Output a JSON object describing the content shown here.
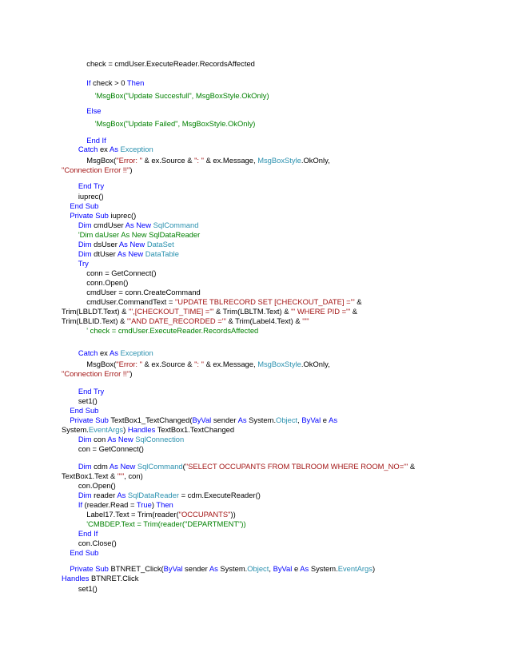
{
  "colors": {
    "default": "#000000",
    "keyword": "#0000ff",
    "type": "#2b91af",
    "string": "#a31515",
    "comment": "#008000"
  },
  "lines": [
    [
      [
        "            check = cmdUser.ExecuteReader.RecordsAffected",
        "default"
      ]
    ],
    [
      [
        "            ",
        "default"
      ],
      [
        "If",
        "keyword"
      ],
      [
        " check > 0 ",
        "default"
      ],
      [
        "Then",
        "keyword"
      ]
    ],
    [
      [
        "                ",
        "default"
      ],
      [
        "'MsgBox(\"Update Succesfull\", MsgBoxStyle.OkOnly)",
        "comment"
      ]
    ],
    [
      [
        "            ",
        "default"
      ],
      [
        "Else",
        "keyword"
      ]
    ],
    [
      [
        "                ",
        "default"
      ],
      [
        "'MsgBox(\"Update Failed\", MsgBoxStyle.OkOnly)",
        "comment"
      ]
    ],
    [
      [
        "            ",
        "default"
      ],
      [
        "End If",
        "keyword"
      ]
    ],
    [
      [
        "        ",
        "default"
      ],
      [
        "Catch",
        "keyword"
      ],
      [
        " ex ",
        "default"
      ],
      [
        "As",
        "keyword"
      ],
      [
        " ",
        "default"
      ],
      [
        "Exception",
        "type"
      ]
    ],
    [
      [
        "            MsgBox(",
        "default"
      ],
      [
        "\"Error: \"",
        "string"
      ],
      [
        " & ex.Source & ",
        "default"
      ],
      [
        "\": \"",
        "string"
      ],
      [
        " & ex.Message, ",
        "default"
      ],
      [
        "MsgBoxStyle",
        "type"
      ],
      [
        ".OkOnly,",
        "default"
      ]
    ],
    [
      [
        "\"Connection Error !!\"",
        "string"
      ],
      [
        ")",
        "default"
      ]
    ],
    [
      [
        "        ",
        "default"
      ],
      [
        "End Try",
        "keyword"
      ]
    ],
    [
      [
        "        iuprec()",
        "default"
      ]
    ],
    [
      [
        "    ",
        "default"
      ],
      [
        "End Sub",
        "keyword"
      ]
    ],
    [
      [
        "    ",
        "default"
      ],
      [
        "Private Sub",
        "keyword"
      ],
      [
        " iuprec()",
        "default"
      ]
    ],
    [
      [
        "        ",
        "default"
      ],
      [
        "Dim",
        "keyword"
      ],
      [
        " cmdUser ",
        "default"
      ],
      [
        "As New",
        "keyword"
      ],
      [
        " ",
        "default"
      ],
      [
        "SqlCommand",
        "type"
      ]
    ],
    [
      [
        "        ",
        "default"
      ],
      [
        "'Dim daUser As New SqlDataReader",
        "comment"
      ]
    ],
    [
      [
        "        ",
        "default"
      ],
      [
        "Dim",
        "keyword"
      ],
      [
        " dsUser ",
        "default"
      ],
      [
        "As New",
        "keyword"
      ],
      [
        " ",
        "default"
      ],
      [
        "DataSet",
        "type"
      ]
    ],
    [
      [
        "        ",
        "default"
      ],
      [
        "Dim",
        "keyword"
      ],
      [
        " dtUser ",
        "default"
      ],
      [
        "As New",
        "keyword"
      ],
      [
        " ",
        "default"
      ],
      [
        "DataTable",
        "type"
      ]
    ],
    [
      [
        "        ",
        "default"
      ],
      [
        "Try",
        "keyword"
      ]
    ],
    [
      [
        "            conn = GetConnect()",
        "default"
      ]
    ],
    [
      [
        "            conn.Open()",
        "default"
      ]
    ],
    [
      [
        "            cmdUser = conn.CreateCommand",
        "default"
      ]
    ],
    [
      [
        "            cmdUser.CommandText = ",
        "default"
      ],
      [
        "\"UPDATE TBLRECORD SET [CHECKOUT_DATE] ='\"",
        "string"
      ],
      [
        " &",
        "default"
      ]
    ],
    [
      [
        "Trim(LBLDT.Text) & ",
        "default"
      ],
      [
        "\"',[CHECKOUT_TIME] ='\"",
        "string"
      ],
      [
        " & Trim(LBLTM.Text) & ",
        "default"
      ],
      [
        "\"' WHERE PID ='\"",
        "string"
      ],
      [
        " &",
        "default"
      ]
    ],
    [
      [
        "Trim(LBLID.Text) & ",
        "default"
      ],
      [
        "\"'AND DATE_RECORDED ='\"",
        "string"
      ],
      [
        " & Trim(Label4.Text) & ",
        "default"
      ],
      [
        "\"'\"",
        "string"
      ]
    ],
    [
      [
        "            ",
        "default"
      ],
      [
        "' check = cmdUser.ExecuteReader.RecordsAffected",
        "comment"
      ]
    ],
    [
      [
        "        ",
        "default"
      ],
      [
        "Catch",
        "keyword"
      ],
      [
        " ex ",
        "default"
      ],
      [
        "As",
        "keyword"
      ],
      [
        " ",
        "default"
      ],
      [
        "Exception",
        "type"
      ]
    ],
    [
      [
        "            MsgBox(",
        "default"
      ],
      [
        "\"Error: \"",
        "string"
      ],
      [
        " & ex.Source & ",
        "default"
      ],
      [
        "\": \"",
        "string"
      ],
      [
        " & ex.Message, ",
        "default"
      ],
      [
        "MsgBoxStyle",
        "type"
      ],
      [
        ".OkOnly,",
        "default"
      ]
    ],
    [
      [
        "\"Connection Error !!\"",
        "string"
      ],
      [
        ")",
        "default"
      ]
    ],
    [
      [
        "        ",
        "default"
      ],
      [
        "End Try",
        "keyword"
      ]
    ],
    [
      [
        "        set1()",
        "default"
      ]
    ],
    [
      [
        "    ",
        "default"
      ],
      [
        "End Sub",
        "keyword"
      ]
    ],
    [
      [
        "    ",
        "default"
      ],
      [
        "Private Sub",
        "keyword"
      ],
      [
        " TextBox1_TextChanged(",
        "default"
      ],
      [
        "ByVal",
        "keyword"
      ],
      [
        " sender ",
        "default"
      ],
      [
        "As",
        "keyword"
      ],
      [
        " System.",
        "default"
      ],
      [
        "Object",
        "type"
      ],
      [
        ", ",
        "default"
      ],
      [
        "ByVal",
        "keyword"
      ],
      [
        " e ",
        "default"
      ],
      [
        "As",
        "keyword"
      ]
    ],
    [
      [
        "System.",
        "default"
      ],
      [
        "EventArgs",
        "type"
      ],
      [
        ") ",
        "default"
      ],
      [
        "Handles",
        "keyword"
      ],
      [
        " TextBox1.TextChanged",
        "default"
      ]
    ],
    [
      [
        "        ",
        "default"
      ],
      [
        "Dim",
        "keyword"
      ],
      [
        " con ",
        "default"
      ],
      [
        "As New",
        "keyword"
      ],
      [
        " ",
        "default"
      ],
      [
        "SqlConnection",
        "type"
      ]
    ],
    [
      [
        "        con = GetConnect()",
        "default"
      ]
    ],
    [
      [
        "        ",
        "default"
      ],
      [
        "Dim",
        "keyword"
      ],
      [
        " cdm ",
        "default"
      ],
      [
        "As New",
        "keyword"
      ],
      [
        " ",
        "default"
      ],
      [
        "SqlCommand",
        "type"
      ],
      [
        "(",
        "default"
      ],
      [
        "\"SELECT OCCUPANTS FROM TBLROOM WHERE ROOM_NO='\"",
        "string"
      ],
      [
        " &",
        "default"
      ]
    ],
    [
      [
        "TextBox1.Text & ",
        "default"
      ],
      [
        "\"'\"",
        "string"
      ],
      [
        ", con)",
        "default"
      ]
    ],
    [
      [
        "        con.Open()",
        "default"
      ]
    ],
    [
      [
        "        ",
        "default"
      ],
      [
        "Dim",
        "keyword"
      ],
      [
        " reader ",
        "default"
      ],
      [
        "As",
        "keyword"
      ],
      [
        " ",
        "default"
      ],
      [
        "SqlDataReader",
        "type"
      ],
      [
        " = cdm.ExecuteReader()",
        "default"
      ]
    ],
    [
      [
        "        ",
        "default"
      ],
      [
        "If",
        "keyword"
      ],
      [
        " (reader.Read = ",
        "default"
      ],
      [
        "True",
        "keyword"
      ],
      [
        ") ",
        "default"
      ],
      [
        "Then",
        "keyword"
      ]
    ],
    [
      [
        "            Label17.Text = Trim(reader(",
        "default"
      ],
      [
        "\"OCCUPANTS\"",
        "string"
      ],
      [
        "))",
        "default"
      ]
    ],
    [
      [
        "            ",
        "default"
      ],
      [
        "'CMBDEP.Text = Trim(reader(\"DEPARTMENT\"))",
        "comment"
      ]
    ],
    [
      [
        "        ",
        "default"
      ],
      [
        "End If",
        "keyword"
      ]
    ],
    [
      [
        "        con.Close()",
        "default"
      ]
    ],
    [
      [
        "    ",
        "default"
      ],
      [
        "End Sub",
        "keyword"
      ]
    ],
    [
      [
        "    ",
        "default"
      ],
      [
        "Private Sub",
        "keyword"
      ],
      [
        " BTNRET_Click(",
        "default"
      ],
      [
        "ByVal",
        "keyword"
      ],
      [
        " sender ",
        "default"
      ],
      [
        "As",
        "keyword"
      ],
      [
        " System.",
        "default"
      ],
      [
        "Object",
        "type"
      ],
      [
        ", ",
        "default"
      ],
      [
        "ByVal",
        "keyword"
      ],
      [
        " e ",
        "default"
      ],
      [
        "As",
        "keyword"
      ],
      [
        " System.",
        "default"
      ],
      [
        "EventArgs",
        "type"
      ],
      [
        ")",
        "default"
      ]
    ],
    [
      [
        "Handles",
        "keyword"
      ],
      [
        " BTNRET.Click",
        "default"
      ]
    ],
    [
      [
        "        set1()",
        "default"
      ]
    ]
  ]
}
